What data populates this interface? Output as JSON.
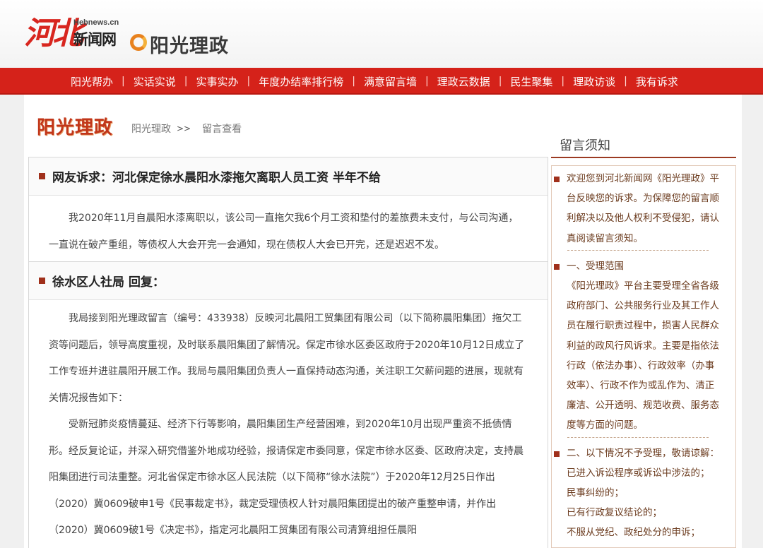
{
  "header": {
    "logo_main": "河北",
    "logo_domain": "Hebnews.cn",
    "logo_news": "新闻网",
    "brand_logo": "阳光理政"
  },
  "nav": {
    "items": [
      "阳光帮办",
      "实话实说",
      "实事实办",
      "年度办结率排行榜",
      "满意留言墙",
      "理政云数据",
      "民生聚集",
      "理政访谈",
      "我有诉求"
    ],
    "separator": "|"
  },
  "page": {
    "brand_title": "阳光理政",
    "breadcrumb": [
      "阳光理政",
      "留言查看"
    ],
    "breadcrumb_sep": ">>"
  },
  "complaint": {
    "title": "网友诉求：河北保定徐水晨阳水漆拖欠离职人员工资 半年不给",
    "body": "我2020年11月自晨阳水漆离职以，该公司一直拖欠我6个月工资和垫付的差旅费未支付，与公司沟通，一直说在破产重组，等债权人大会开完一会通知，现在债权人大会已开完，还是迟迟不发。"
  },
  "reply": {
    "title": "徐水区人社局 回复：",
    "paragraphs": [
      "我局接到阳光理政留言（编号：433938）反映河北晨阳工贸集团有限公司（以下简称晨阳集团）拖欠工资等问题后，领导高度重视，及时联系晨阳集团了解情况。保定市徐水区委区政府于2020年10月12日成立了工作专班并进驻晨阳开展工作。我局与晨阳集团负责人一直保持动态沟通，关注职工欠薪问题的进展，现就有关情况报告如下：",
      "受新冠肺炎疫情蔓延、经济下行等影响，晨阳集团生产经营困难，到2020年10月出现严重资不抵债情形。经反复论证，并深入研究借鉴外地成功经验，报请保定市委同意，保定市徐水区委、区政府决定，支持晨阳集团进行司法重整。河北省保定市徐水区人民法院（以下简称“徐水法院”）于2020年12月25日作出（2020）冀0609破申1号《民事裁定书》，裁定受理债权人针对晨阳集团提出的破产重整申请，并作出（2020）冀0609破1号《决定书》，指定河北晨阳工贸集团有限公司清算组担任晨阳"
    ]
  },
  "sidebar": {
    "title": "留言须知",
    "blocks": [
      [
        "欢迎您到河北新闻网《阳光理政》平",
        "台反映您的诉求。为保障您的留言顺",
        "利解决以及他人权利不受侵犯，请认",
        "真阅读留言须知。"
      ],
      [
        "一、受理范围",
        "《阳光理政》平台主要受理全省各级",
        "政府部门、公共服务行业及其工作人",
        "员在履行职责过程中，损害人民群众",
        "利益的政风行风诉求。主要是指依法",
        "行政（依法办事）、行政效率（办事",
        "效率）、行政不作为或乱作为、清正",
        "廉洁、公开透明、规范收费、服务态",
        "度等方面的问题。"
      ],
      [
        "二、以下情况不予受理，敬请谅解：",
        "已进入诉讼程序或诉讼中涉法的；",
        "民事纠纷的；",
        "已有行政复议结论的；",
        "不服从党纪、政纪处分的申诉；"
      ]
    ]
  }
}
